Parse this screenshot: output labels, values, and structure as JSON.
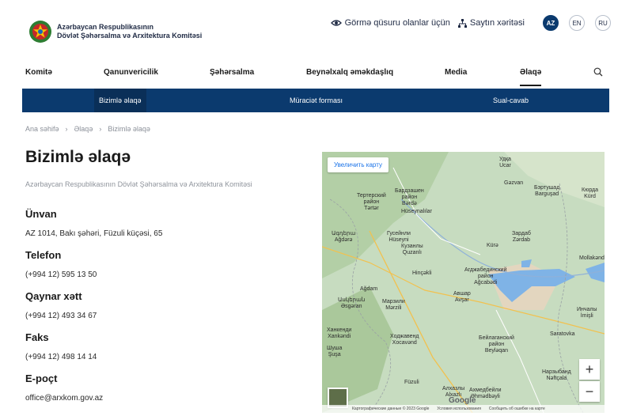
{
  "header": {
    "org_line1": "Azərbaycan Respublikasının",
    "org_line2": "Dövlət Şəhərsalma və Arxitektura Komitəsi",
    "accessibility": "Görmə qüsuru olanlar üçün",
    "sitemap": "Saytın xəritəsi",
    "languages": [
      "AZ",
      "EN",
      "RU"
    ],
    "active_language": "AZ"
  },
  "nav": {
    "items": [
      "Komitə",
      "Qanunvericilik",
      "Şəhərsalma",
      "Beynəlxalq əməkdaşlıq",
      "Media",
      "Əlaqə"
    ],
    "active": "Əlaqə"
  },
  "subnav": {
    "items": [
      "Bizimlə əlaqə",
      "Müraciət forması",
      "Sual-cavab"
    ],
    "active": "Bizimlə əlaqə"
  },
  "breadcrumb": [
    "Ana səhifə",
    "Əlaqə",
    "Bizimlə əlaqə"
  ],
  "page": {
    "title": "Bizimlə əlaqə",
    "subtitle": "Azərbaycan Respublikasının Dövlət Şəhərsalma və Arxitektura Komitəsi"
  },
  "contacts": [
    {
      "label": "Ünvan",
      "value": "AZ 1014, Bakı şəhəri, Füzuli küçəsi, 65"
    },
    {
      "label": "Telefon",
      "value": "(+994 12) 595 13 50"
    },
    {
      "label": "Qaynar xətt",
      "value": "(+994 12) 493 34 67"
    },
    {
      "label": "Faks",
      "value": "(+994 12) 498 14 14"
    },
    {
      "label": "E-poçt",
      "value": "office@arxkom.gov.az"
    }
  ],
  "map": {
    "enlarge_button": "Увеличить карту",
    "zoom_in": "+",
    "zoom_out": "−",
    "google": "Google",
    "footer": [
      "Картографические данные © 2023 Google",
      "Условия использования",
      "Сообщить об ошибке на карте"
    ],
    "places": [
      {
        "text": "Удқа\nUcar"
      },
      {
        "text": "Gəzvan"
      },
      {
        "text": "Бэртушад\nBarguşad"
      },
      {
        "text": "Кюрда\nKürd"
      },
      {
        "text": "Бардзашен\nрайон\nBərdə"
      },
      {
        "text": "Тертерский\nрайон\nTərtər"
      },
      {
        "text": "Hüseynalılar"
      },
      {
        "text": "Ագդերա\nAğdərə"
      },
      {
        "text": "Гусейнли\nHüseyni"
      },
      {
        "text": "Зардаб\nZərdab"
      },
      {
        "text": "Кузанлы\nQuzanlı"
      },
      {
        "text": "Kürə"
      },
      {
        "text": "Mollakənd"
      },
      {
        "text": "Hinçəkli"
      },
      {
        "text": "Агджабединский\nрайон\nAğcabədi"
      },
      {
        "text": "Ağdam"
      },
      {
        "text": "Авшар\nAvşar"
      },
      {
        "text": "Ասկերան\nƏsgəran"
      },
      {
        "text": "Марзили\nMərzili"
      },
      {
        "text": "Инчалы\nİmişli"
      },
      {
        "text": "Ханкенди\nXankəndi"
      },
      {
        "text": "Ходжавенд\nXocavənd"
      },
      {
        "text": "Бейлаганский\nрайон\nBeyləqan"
      },
      {
        "text": "Saratovka"
      },
      {
        "text": "Шуша\nŞuşa"
      },
      {
        "text": "Нарзыбанд\nNəftçala"
      },
      {
        "text": "Füzuli"
      },
      {
        "text": "Алхазлы\nAlxazlı"
      },
      {
        "text": "Ахмедбейли\nƏhmədbəyli"
      }
    ]
  },
  "colors": {
    "nav_bg": "#0b3a6e",
    "active_lang": "#0b3a6e",
    "map_land": "#c7dcc0",
    "map_water": "#7fb3e6"
  }
}
